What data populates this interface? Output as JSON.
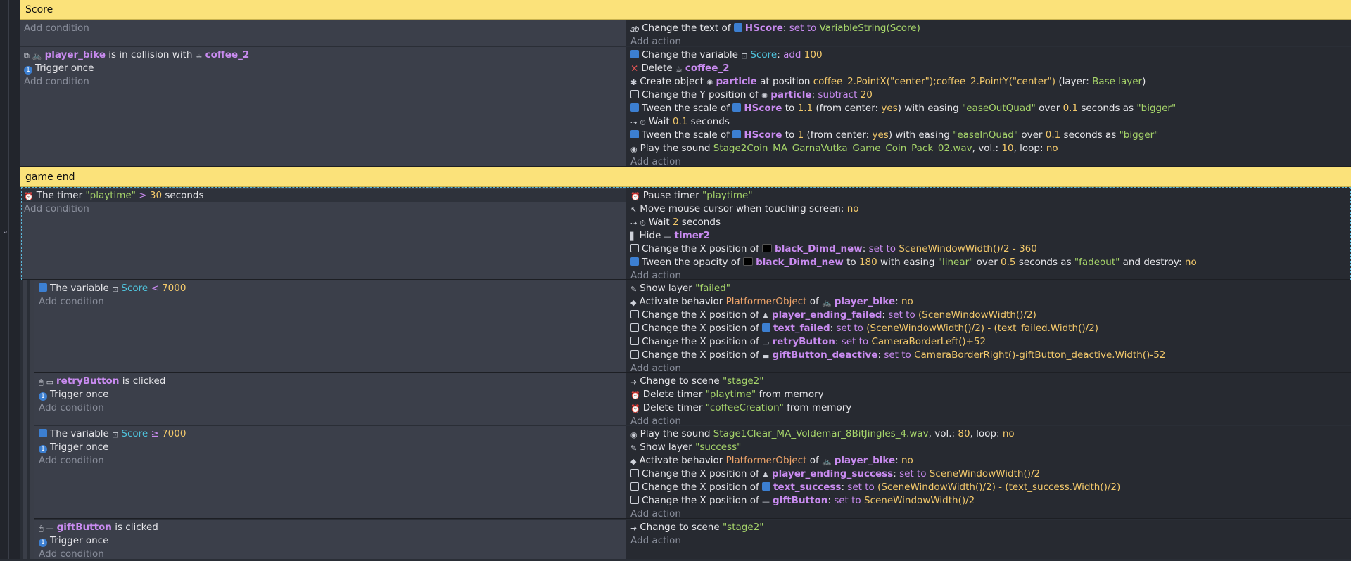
{
  "add_condition": "Add condition",
  "add_action": "Add action",
  "comment_score": "Score",
  "comment_gameend": "game end",
  "e1": {
    "a1": {
      "t1": "Change the text of ",
      "o": "HScore",
      "t2": ": ",
      "op": "set to",
      "t3": " ",
      "v": "VariableString(Score)"
    }
  },
  "e2": {
    "c1": {
      "o1": "player_bike",
      "t": " is in collision with ",
      "o2": "coffee_2"
    },
    "c2": "Trigger once",
    "a1": {
      "t1": "Change the variable ",
      "var": "Score",
      "t2": ": ",
      "op": "add",
      "t3": " ",
      "v": "100"
    },
    "a2": {
      "t1": "Delete ",
      "o": "coffee_2"
    },
    "a3": {
      "t1": "Create object ",
      "o": "particle",
      "t2": " at position ",
      "e": "coffee_2.PointX(\"center\");coffee_2.PointY(\"center\")",
      "t3": " (layer: ",
      "l": "Base layer",
      "t4": ")"
    },
    "a4": {
      "t1": "Change the Y position of ",
      "o": "particle",
      "t2": ": ",
      "op": "subtract",
      "t3": " ",
      "v": "20"
    },
    "a5": {
      "t1": "Tween the scale of ",
      "o": "HScore",
      "t2": " to ",
      "v1": "1.1",
      "t3": " (from center: ",
      "v2": "yes",
      "t4": ") with easing ",
      "s1": "\"easeOutQuad\"",
      "t5": " over ",
      "v3": "0.1",
      "t6": " seconds as ",
      "s2": "\"bigger\""
    },
    "a6": {
      "t1": "Wait ",
      "v": "0.1",
      "t2": " seconds"
    },
    "a7": {
      "t1": "Tween the scale of ",
      "o": "HScore",
      "t2": " to ",
      "v1": "1",
      "t3": " (from center: ",
      "v2": "yes",
      "t4": ") with easing ",
      "s1": "\"easeInQuad\"",
      "t5": " over ",
      "v3": "0.1",
      "t6": " seconds as ",
      "s2": "\"bigger\""
    },
    "a8": {
      "t1": "Play the sound ",
      "s": "Stage2Coin_MA_GarnaVutka_Game_Coin_Pack_02.wav",
      "t2": ", vol.: ",
      "v1": "10",
      "t3": ", loop: ",
      "v2": "no"
    }
  },
  "e3": {
    "c1": {
      "t1": "The timer ",
      "s": "\"playtime\"",
      "t2": " ",
      "op": ">",
      "t3": " ",
      "v": "30",
      "t4": " seconds"
    },
    "a1": {
      "t1": "Pause timer ",
      "s": "\"playtime\""
    },
    "a2": {
      "t1": "Move mouse cursor when touching screen: ",
      "v": "no"
    },
    "a3": {
      "t1": "Wait ",
      "v": "2",
      "t2": " seconds"
    },
    "a4": {
      "t1": "Hide ",
      "o": "timer2"
    },
    "a5": {
      "t1": "Change the X position of ",
      "o": "black_Dimd_new",
      "t2": ": ",
      "op": "set to",
      "t3": " ",
      "v": "SceneWindowWidth()/2 - 360"
    },
    "a6": {
      "t1": "Tween the opacity of ",
      "o": "black_Dimd_new",
      "t2": " to ",
      "v1": "180",
      "t3": " with easing ",
      "s1": "\"linear\"",
      "t4": " over ",
      "v2": "0.5",
      "t5": " seconds as ",
      "s2": "\"fadeout\"",
      "t6": " and destroy: ",
      "v3": "no"
    }
  },
  "e4": {
    "c1": {
      "t1": "The variable ",
      "var": "Score",
      "t2": " ",
      "op": "<",
      "t3": " ",
      "v": "7000"
    },
    "a1": {
      "t1": "Show layer ",
      "s": "\"failed\""
    },
    "a2": {
      "t1": "Activate behavior ",
      "b": "PlatformerObject",
      "t2": " of ",
      "o": "player_bike",
      "t3": ": ",
      "v": "no"
    },
    "a3": {
      "t1": "Change the X position of ",
      "o": "player_ending_failed",
      "t2": ": ",
      "op": "set to",
      "t3": " ",
      "v": "(SceneWindowWidth()/2)"
    },
    "a4": {
      "t1": "Change the X position of ",
      "o": "text_failed",
      "t2": ": ",
      "op": "set to",
      "t3": " ",
      "v": "(SceneWindowWidth()/2) - (text_failed.Width()/2)"
    },
    "a5": {
      "t1": "Change the X position of ",
      "o": "retryButton",
      "t2": ": ",
      "op": "set to",
      "t3": " ",
      "v": "CameraBorderLeft()+52"
    },
    "a6": {
      "t1": "Change the X position of ",
      "o": "giftButton_deactive",
      "t2": ": ",
      "op": "set to",
      "t3": " ",
      "v": "CameraBorderRight()-giftButton_deactive.Width()-52"
    }
  },
  "e5": {
    "c1": {
      "o": "retryButton",
      "t": " is clicked"
    },
    "c2": "Trigger once",
    "a1": {
      "t1": "Change to scene ",
      "s": "\"stage2\""
    },
    "a2": {
      "t1": "Delete timer ",
      "s": "\"playtime\"",
      "t2": " from memory"
    },
    "a3": {
      "t1": "Delete timer ",
      "s": "\"coffeeCreation\"",
      "t2": " from memory"
    }
  },
  "e6": {
    "c1": {
      "t1": "The variable ",
      "var": "Score",
      "t2": " ",
      "op": "≥",
      "t3": " ",
      "v": "7000"
    },
    "c2": "Trigger once",
    "a1": {
      "t1": "Play the sound ",
      "s": "Stage1Clear_MA_Voldemar_8BitJingles_4.wav",
      "t2": ", vol.: ",
      "v1": "80",
      "t3": ", loop: ",
      "v2": "no"
    },
    "a2": {
      "t1": "Show layer ",
      "s": "\"success\""
    },
    "a3": {
      "t1": "Activate behavior ",
      "b": "PlatformerObject",
      "t2": " of ",
      "o": "player_bike",
      "t3": ": ",
      "v": "no"
    },
    "a4": {
      "t1": "Change the X position of ",
      "o": "player_ending_success",
      "t2": ": ",
      "op": "set to",
      "t3": " ",
      "v": "SceneWindowWidth()/2"
    },
    "a5": {
      "t1": "Change the X position of ",
      "o": "text_success",
      "t2": ": ",
      "op": "set to",
      "t3": " ",
      "v": "(SceneWindowWidth()/2) - (text_success.Width()/2)"
    },
    "a6": {
      "t1": "Change the X position of ",
      "o": "giftButton",
      "t2": ": ",
      "op": "set to",
      "t3": " ",
      "v": "SceneWindowWidth()/2"
    }
  },
  "e7": {
    "c1": {
      "o": "giftButton",
      "t": " is clicked"
    },
    "c2": "Trigger once",
    "a1": {
      "t1": "Change to scene ",
      "s": "\"stage2\""
    }
  }
}
